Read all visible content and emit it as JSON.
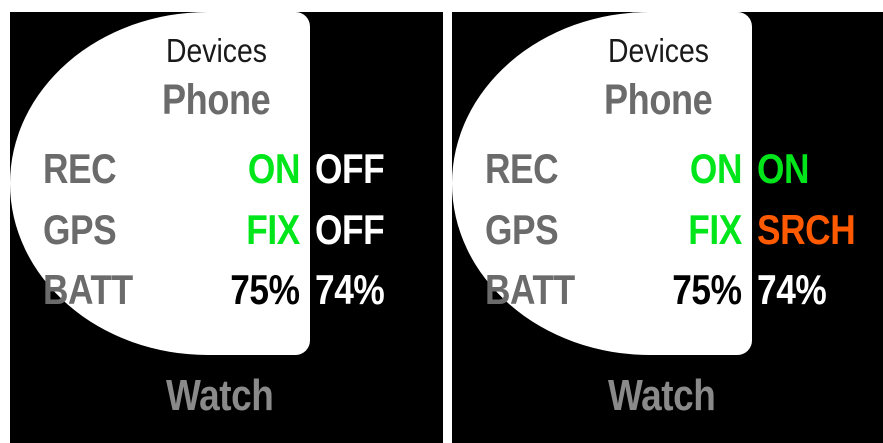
{
  "colors": {
    "on": "#00e61a",
    "off": "#ffffff",
    "srch": "#ff5a00",
    "batt_phone": "#000000",
    "batt_watch": "#ffffff",
    "label": "#6b6b6b"
  },
  "screens": [
    {
      "title": "Devices",
      "phone_label": "Phone",
      "watch_label": "Watch",
      "rows": [
        {
          "label": "REC",
          "phone": "ON",
          "watch": "OFF"
        },
        {
          "label": "GPS",
          "phone": "FIX",
          "watch": "OFF"
        },
        {
          "label": "BATT",
          "phone": "75%",
          "watch": "74%"
        }
      ]
    },
    {
      "title": "Devices",
      "phone_label": "Phone",
      "watch_label": "Watch",
      "rows": [
        {
          "label": "REC",
          "phone": "ON",
          "watch": "ON"
        },
        {
          "label": "GPS",
          "phone": "FIX",
          "watch": "SRCH"
        },
        {
          "label": "BATT",
          "phone": "75%",
          "watch": "74%"
        }
      ]
    }
  ]
}
